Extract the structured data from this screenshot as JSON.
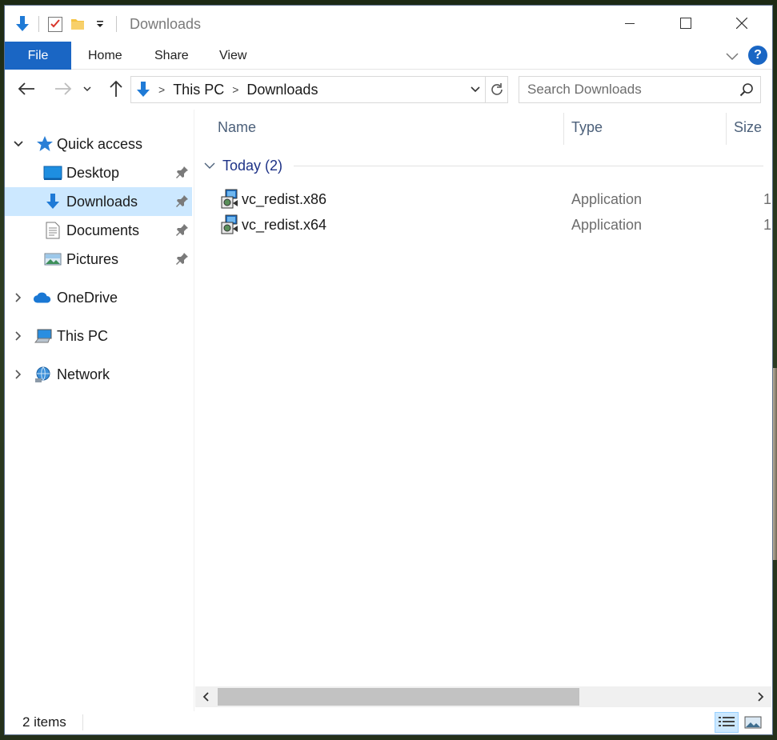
{
  "window": {
    "title": "Downloads"
  },
  "window_controls": {
    "minimize": "—",
    "maximize": "☐",
    "close": "✕"
  },
  "ribbon": {
    "file_label": "File",
    "tabs": [
      "Home",
      "Share",
      "View"
    ],
    "help": "?"
  },
  "address": {
    "segments": [
      "This PC",
      "Downloads"
    ]
  },
  "search": {
    "placeholder": "Search Downloads"
  },
  "nav": {
    "quick_access": "Quick access",
    "items": [
      {
        "label": "Desktop",
        "pinned": true
      },
      {
        "label": "Downloads",
        "pinned": true,
        "selected": true
      },
      {
        "label": "Documents",
        "pinned": true
      },
      {
        "label": "Pictures",
        "pinned": true
      }
    ],
    "onedrive": "OneDrive",
    "thispc": "This PC",
    "network": "Network"
  },
  "columns": {
    "name": "Name",
    "type": "Type",
    "size": "Size"
  },
  "group": {
    "label": "Today (2)"
  },
  "files": [
    {
      "name": "vc_redist.x86",
      "type": "Application",
      "size": "1"
    },
    {
      "name": "vc_redist.x64",
      "type": "Application",
      "size": "1"
    }
  ],
  "status": {
    "items": "2 items"
  },
  "scroll": {
    "position_fraction": 0.0,
    "visible_fraction": 0.68
  },
  "colors": {
    "accent": "#1a66c4",
    "selection": "#cce8ff",
    "group_label": "#1e3287"
  }
}
